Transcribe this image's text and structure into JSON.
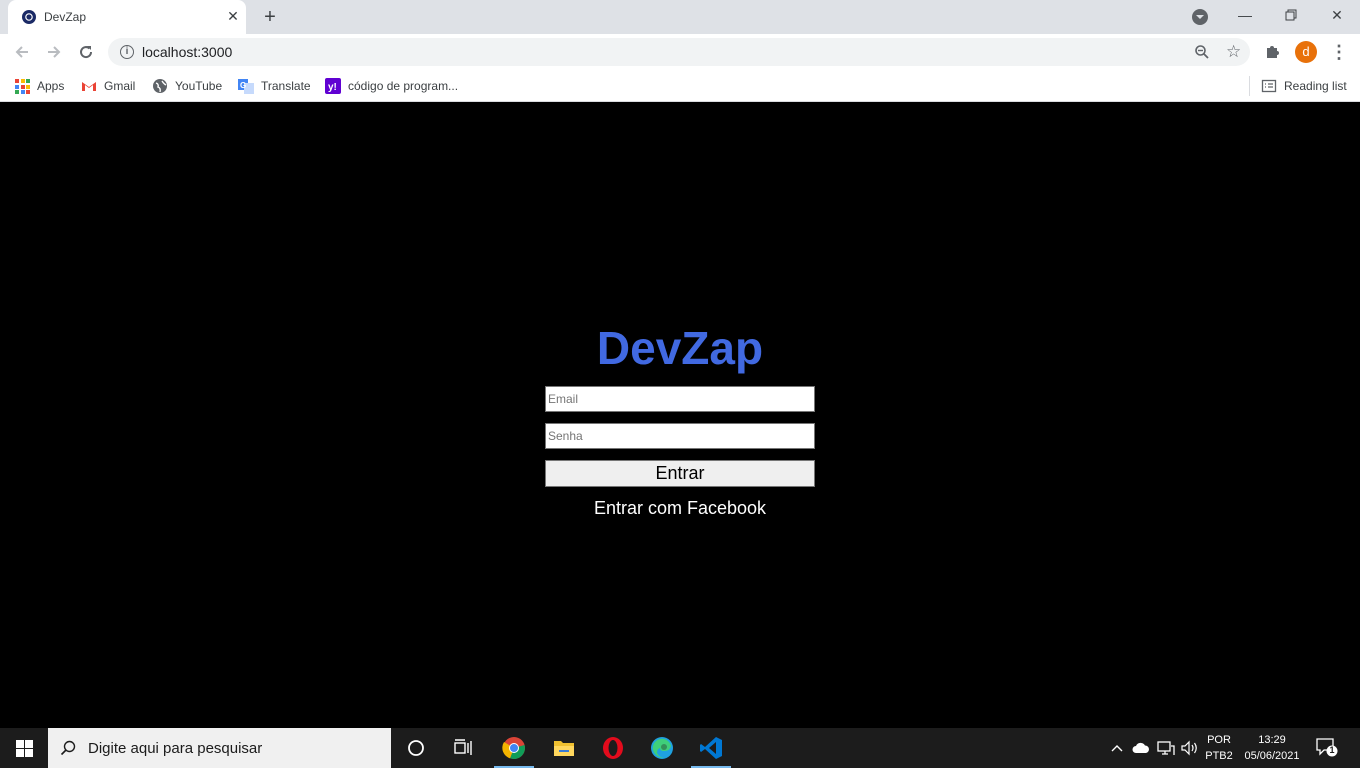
{
  "browser": {
    "tab_title": "DevZap",
    "url": "localhost:3000",
    "bookmarks": [
      {
        "label": "Apps",
        "icon": "apps-grid-icon"
      },
      {
        "label": "Gmail",
        "icon": "gmail-icon"
      },
      {
        "label": "YouTube",
        "icon": "globe-icon"
      },
      {
        "label": "Translate",
        "icon": "translate-icon"
      },
      {
        "label": "código de program...",
        "icon": "yahoo-icon"
      }
    ],
    "reading_list": "Reading list",
    "profile_initial": "d"
  },
  "page": {
    "brand": "DevZap",
    "brand_color": "#4169e1",
    "email_placeholder": "Email",
    "password_placeholder": "Senha",
    "enter_label": "Entrar",
    "facebook_label": "Entrar com Facebook"
  },
  "taskbar": {
    "search_placeholder": "Digite aqui para pesquisar",
    "lang_line1": "POR",
    "lang_line2": "PTB2",
    "time": "13:29",
    "date": "05/06/2021",
    "notification_count": "1"
  }
}
